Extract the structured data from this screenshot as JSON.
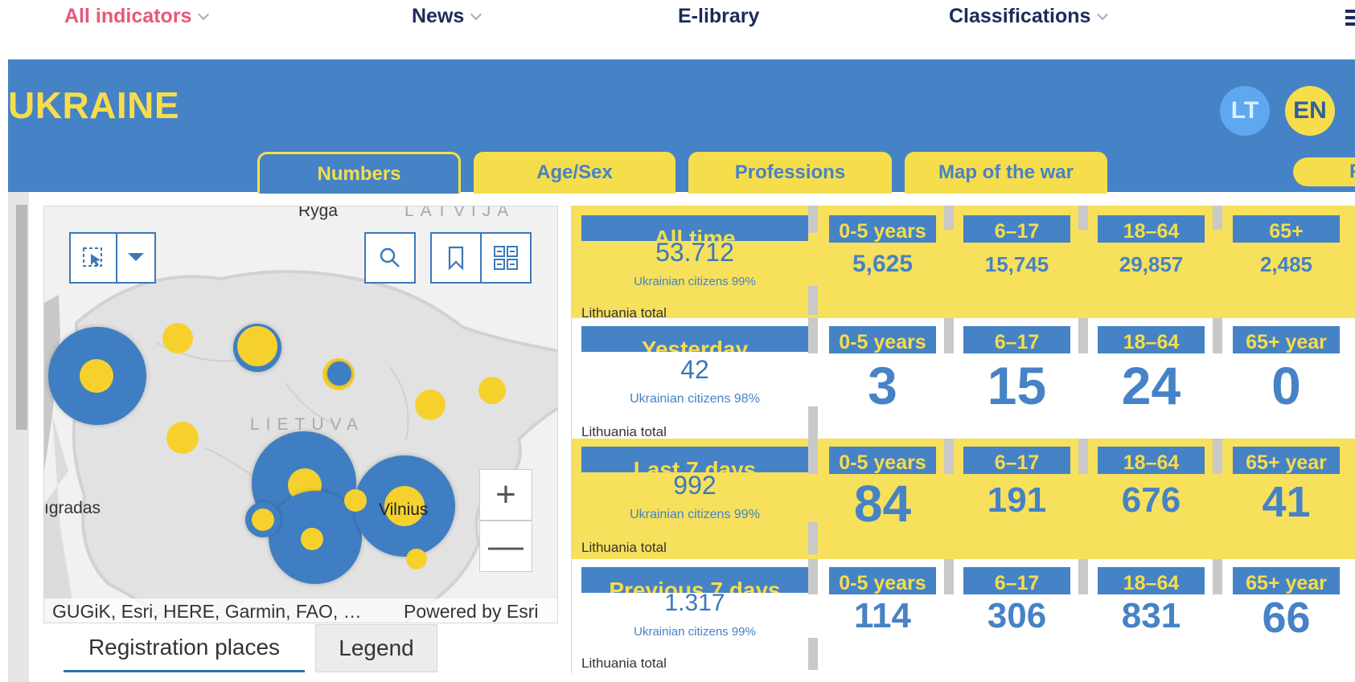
{
  "nav": {
    "items": [
      {
        "label": "All indicators",
        "active": true,
        "dropdown": true
      },
      {
        "label": "News",
        "active": false,
        "dropdown": true
      },
      {
        "label": "E-library",
        "active": false,
        "dropdown": false
      },
      {
        "label": "Classifications",
        "active": false,
        "dropdown": true
      }
    ]
  },
  "banner": {
    "title": "UKRAINE",
    "lang_lt": "LT",
    "lang_en": "EN",
    "tabs": [
      "Numbers",
      "Age/Sex",
      "Professions",
      "Map of the war"
    ],
    "tab_partial": "Fe"
  },
  "map": {
    "labels": {
      "ryga": "Ryga",
      "latvija": "LATVIJA",
      "lietuva": "LIETUVA",
      "karaliaucius": "ıgradas",
      "vilnius": "Vilnius"
    },
    "attribution": "GUGiK, Esri, HERE, Garmin, FAO, …",
    "powered_by": "Powered by Esri",
    "zoom_in": "+",
    "zoom_out": "—",
    "tabs": {
      "registration": "Registration places",
      "legend": "Legend"
    }
  },
  "stats": {
    "rows": [
      {
        "label": "All time",
        "total": "53.712",
        "note": "Ukrainian citizens 99%",
        "lt_total": "Lithuania total",
        "ages": [
          {
            "label": "0-5 years",
            "value": "5,625"
          },
          {
            "label": "6–17",
            "value": "15,745"
          },
          {
            "label": "18–64",
            "value": "29,857"
          },
          {
            "label": "65+",
            "value": "2,485"
          }
        ]
      },
      {
        "label": "Yesterday",
        "total": "42",
        "note": "Ukrainian citizens 98%",
        "lt_total": "Lithuania total",
        "ages": [
          {
            "label": "0-5 years",
            "value": "3"
          },
          {
            "label": "6–17",
            "value": "15"
          },
          {
            "label": "18–64",
            "value": "24"
          },
          {
            "label": "65+ year",
            "value": "0"
          }
        ]
      },
      {
        "label": "Last 7 days",
        "total": "992",
        "note": "Ukrainian citizens 99%",
        "lt_total": "Lithuania total",
        "ages": [
          {
            "label": "0-5 years",
            "value": "84"
          },
          {
            "label": "6–17",
            "value": "191"
          },
          {
            "label": "18–64",
            "value": "676"
          },
          {
            "label": "65+ year",
            "value": "41"
          }
        ]
      },
      {
        "label": "Previous 7 days",
        "total": "1.317",
        "note": "Ukrainian citizens 99%",
        "lt_total": "Lithuania total",
        "ages": [
          {
            "label": "0-5 years",
            "value": "114"
          },
          {
            "label": "6–17",
            "value": "306"
          },
          {
            "label": "18–64",
            "value": "831"
          },
          {
            "label": "65+ year",
            "value": "66"
          }
        ]
      }
    ]
  },
  "colors": {
    "blue": "#4682c6",
    "yellow": "#f6dd4b",
    "pink": "#e8587a",
    "navy": "#1d2b5b"
  }
}
